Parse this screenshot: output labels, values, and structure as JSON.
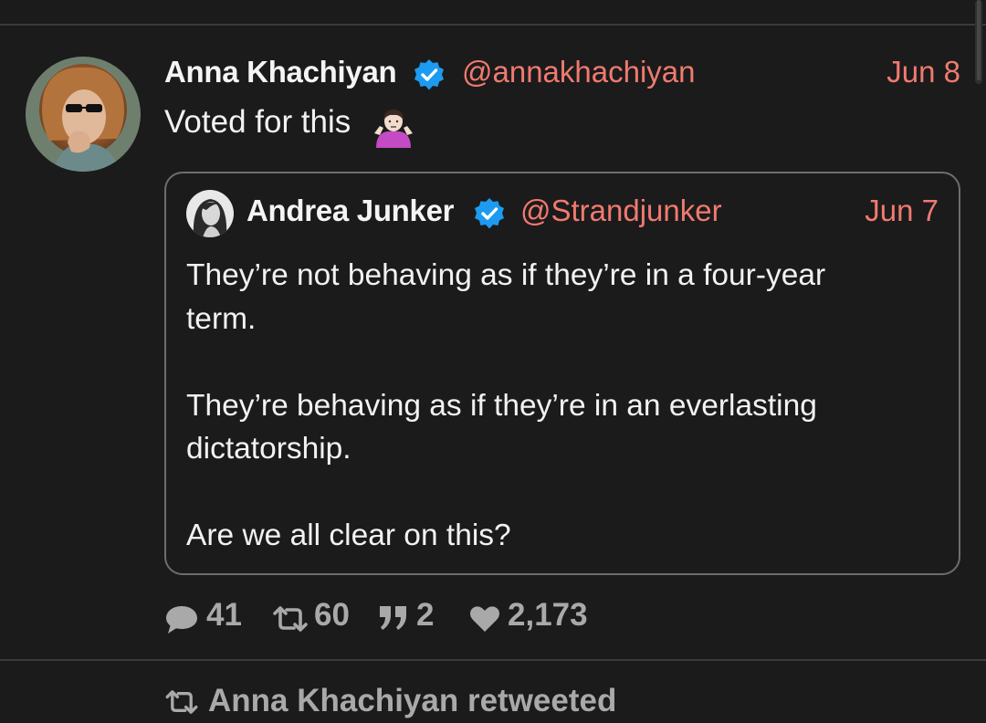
{
  "tweet": {
    "author_name": "Anna Khachiyan",
    "author_handle": "@annakhachiyan",
    "date": "Jun 8",
    "text": "Voted for this",
    "emoji_name": "person-shrugging-emoji"
  },
  "quote": {
    "author_name": "Andrea Junker",
    "author_handle": "@Strandjunker",
    "date": "Jun 7",
    "paragraphs": [
      [
        "They’re not behaving as if they’re in a four-year",
        "term."
      ],
      [
        "They’re behaving as if they’re in an everlasting",
        "dictatorship."
      ],
      [
        "Are we all clear on this?"
      ]
    ]
  },
  "actions": {
    "replies": "41",
    "retweets": "60",
    "quotes": "2",
    "likes": "2,173"
  },
  "next_item": {
    "retweeted_label": "Anna Khachiyan retweeted"
  },
  "icons": {
    "verified": "verified-badge-icon",
    "reply": "speech-bubble-icon",
    "retweet": "retweet-icon",
    "quote": "quote-marks-icon",
    "like": "heart-icon"
  },
  "colors": {
    "background": "#1b1b1b",
    "accent": "#f07a70",
    "verified": "#1d9bf0",
    "muted": "#a9a9a9",
    "text": "#f2f2f2"
  }
}
